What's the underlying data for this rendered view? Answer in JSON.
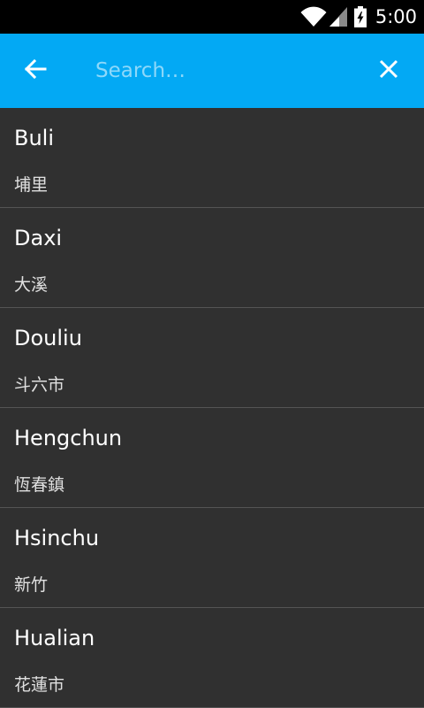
{
  "status_bar": {
    "time": "5:00",
    "icons": [
      "wifi-icon",
      "signal-icon",
      "battery-icon"
    ]
  },
  "toolbar": {
    "background_color": "#03a9f4",
    "back_icon": "arrow-left-icon",
    "search_placeholder": "Search…",
    "search_value": "",
    "clear_icon": "close-icon"
  },
  "list": {
    "items": [
      {
        "name": "Buli",
        "native": "埔里"
      },
      {
        "name": "Daxi",
        "native": "大溪"
      },
      {
        "name": "Douliu",
        "native": "斗六市"
      },
      {
        "name": "Hengchun",
        "native": "恆春鎮"
      },
      {
        "name": "Hsinchu",
        "native": "新竹"
      },
      {
        "name": "Hualian",
        "native": "花蓮市"
      }
    ]
  }
}
